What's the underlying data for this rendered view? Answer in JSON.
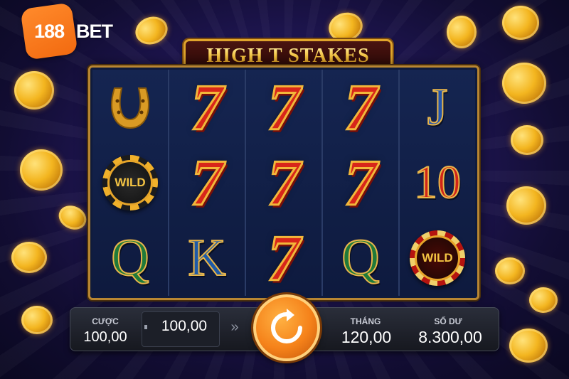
{
  "brand": {
    "logo_number": "188",
    "logo_text": "BET"
  },
  "game": {
    "title": "HIGH T STAKES"
  },
  "reels": [
    [
      "horseshoe",
      "wild",
      "Q"
    ],
    [
      "7",
      "7",
      "K"
    ],
    [
      "7",
      "7",
      "7"
    ],
    [
      "7",
      "7",
      "Q"
    ],
    [
      "J",
      "10",
      "wild"
    ]
  ],
  "symbols": {
    "wild_label": "WILD",
    "seven": "7",
    "q": "Q",
    "k": "K",
    "j": "J",
    "ten": "10"
  },
  "controls": {
    "bet_label": "CƯỢC",
    "bet_value": "100,00",
    "stake_value": "100,00",
    "fast_icon": "»",
    "spin_icon": "refresh-icon",
    "win_label": "THÁNG",
    "win_value": "120,00",
    "balance_label": "SỐ DƯ",
    "balance_value": "8.300,00"
  },
  "colors": {
    "accent": "#f5821a",
    "gold": "#e0a52c",
    "background": "#22185a"
  }
}
